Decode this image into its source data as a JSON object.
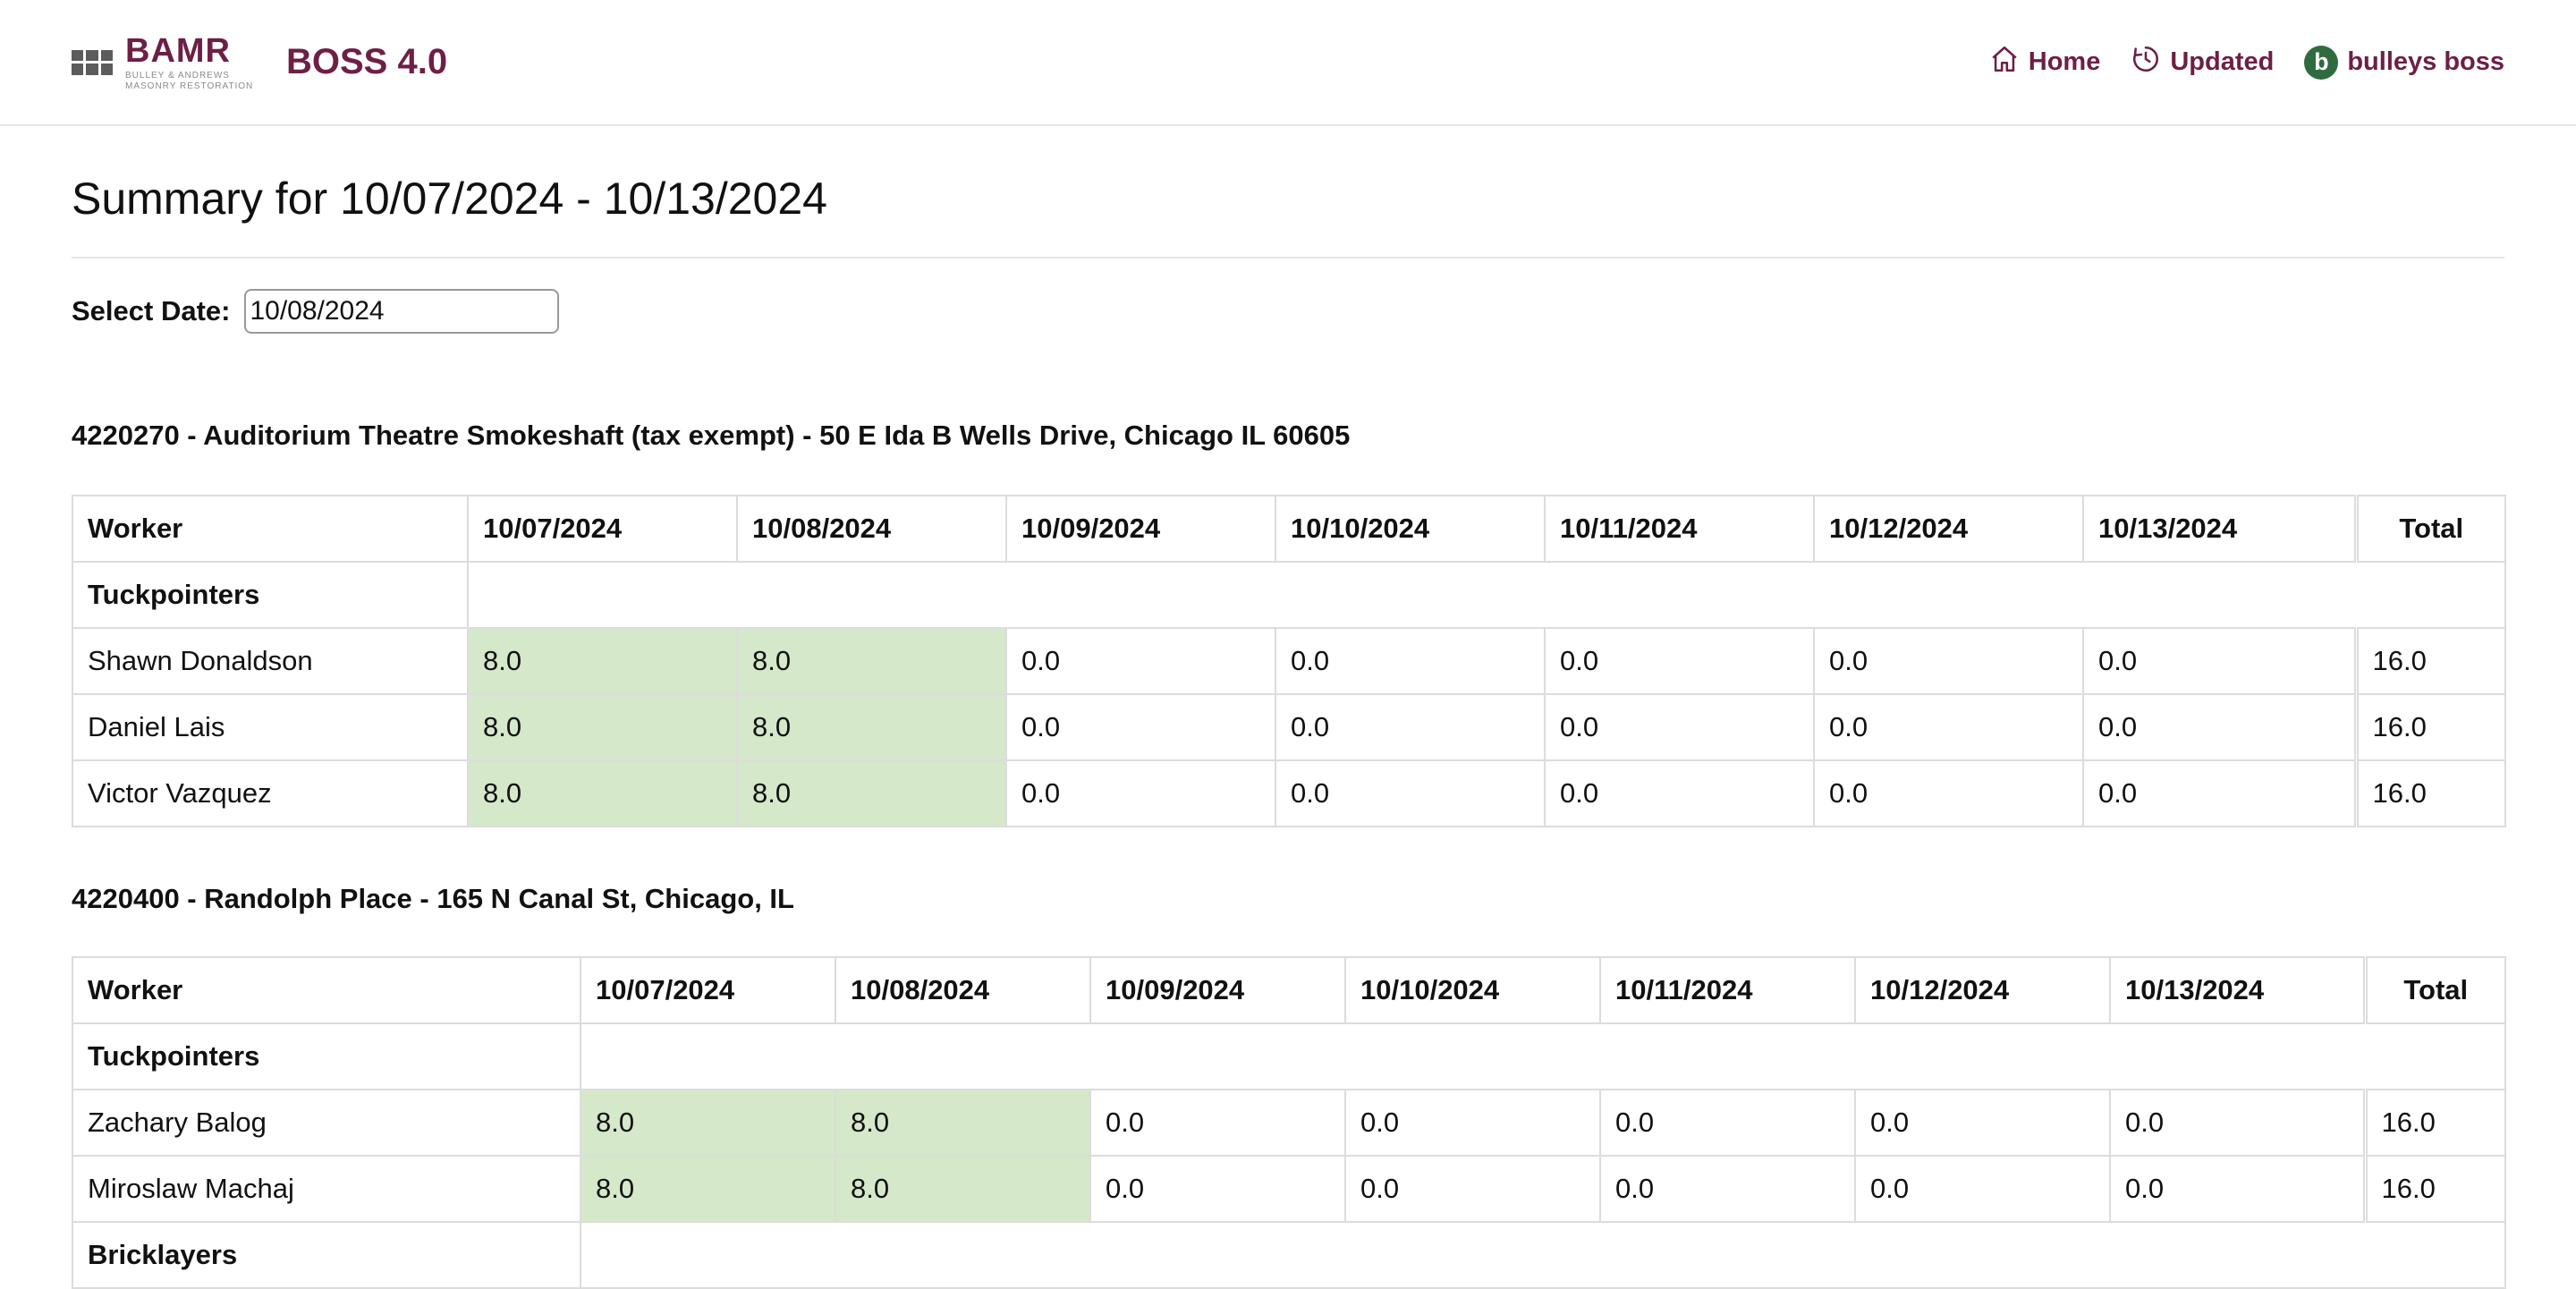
{
  "header": {
    "logo_main": "BAMR",
    "logo_sub_1": "BULLEY & ANDREWS",
    "logo_sub_2": "MASONRY RESTORATION",
    "app_title": "BOSS 4.0",
    "nav": {
      "home": "Home",
      "updated": "Updated",
      "avatar_initial": "b",
      "user": "bulleys boss"
    }
  },
  "page": {
    "title": "Summary for 10/07/2024 - 10/13/2024",
    "select_date_label": "Select Date:",
    "select_date_value": "10/08/2024"
  },
  "columns": {
    "worker": "Worker",
    "dates": [
      "10/07/2024",
      "10/08/2024",
      "10/09/2024",
      "10/10/2024",
      "10/11/2024",
      "10/12/2024",
      "10/13/2024"
    ],
    "total": "Total"
  },
  "jobs": [
    {
      "title": "4220270 - Auditorium Theatre Smokeshaft (tax exempt) - 50 E Ida B Wells Drive, Chicago IL 60605",
      "groups": [
        {
          "name": "Tuckpointers",
          "workers": [
            {
              "name": "Shawn Donaldson",
              "hours": [
                "8.0",
                "8.0",
                "0.0",
                "0.0",
                "0.0",
                "0.0",
                "0.0"
              ],
              "total": "16.0"
            },
            {
              "name": "Daniel Lais",
              "hours": [
                "8.0",
                "8.0",
                "0.0",
                "0.0",
                "0.0",
                "0.0",
                "0.0"
              ],
              "total": "16.0"
            },
            {
              "name": "Victor Vazquez",
              "hours": [
                "8.0",
                "8.0",
                "0.0",
                "0.0",
                "0.0",
                "0.0",
                "0.0"
              ],
              "total": "16.0"
            }
          ]
        }
      ]
    },
    {
      "title": "4220400 - Randolph Place - 165 N Canal St, Chicago, IL",
      "groups": [
        {
          "name": "Tuckpointers",
          "workers": [
            {
              "name": "Zachary Balog",
              "hours": [
                "8.0",
                "8.0",
                "0.0",
                "0.0",
                "0.0",
                "0.0",
                "0.0"
              ],
              "total": "16.0"
            },
            {
              "name": "Miroslaw Machaj",
              "hours": [
                "8.0",
                "8.0",
                "0.0",
                "0.0",
                "0.0",
                "0.0",
                "0.0"
              ],
              "total": "16.0"
            }
          ]
        },
        {
          "name": "Bricklayers",
          "workers": []
        }
      ]
    }
  ],
  "colors": {
    "brand": "#6d1f46",
    "worked_cell": "#d5e8ca",
    "avatar": "#2f6b3f",
    "border": "#dcdcdc"
  },
  "icons": {
    "home": "home-icon",
    "updated": "history-clock-icon",
    "logo": "brick-logo-icon"
  }
}
